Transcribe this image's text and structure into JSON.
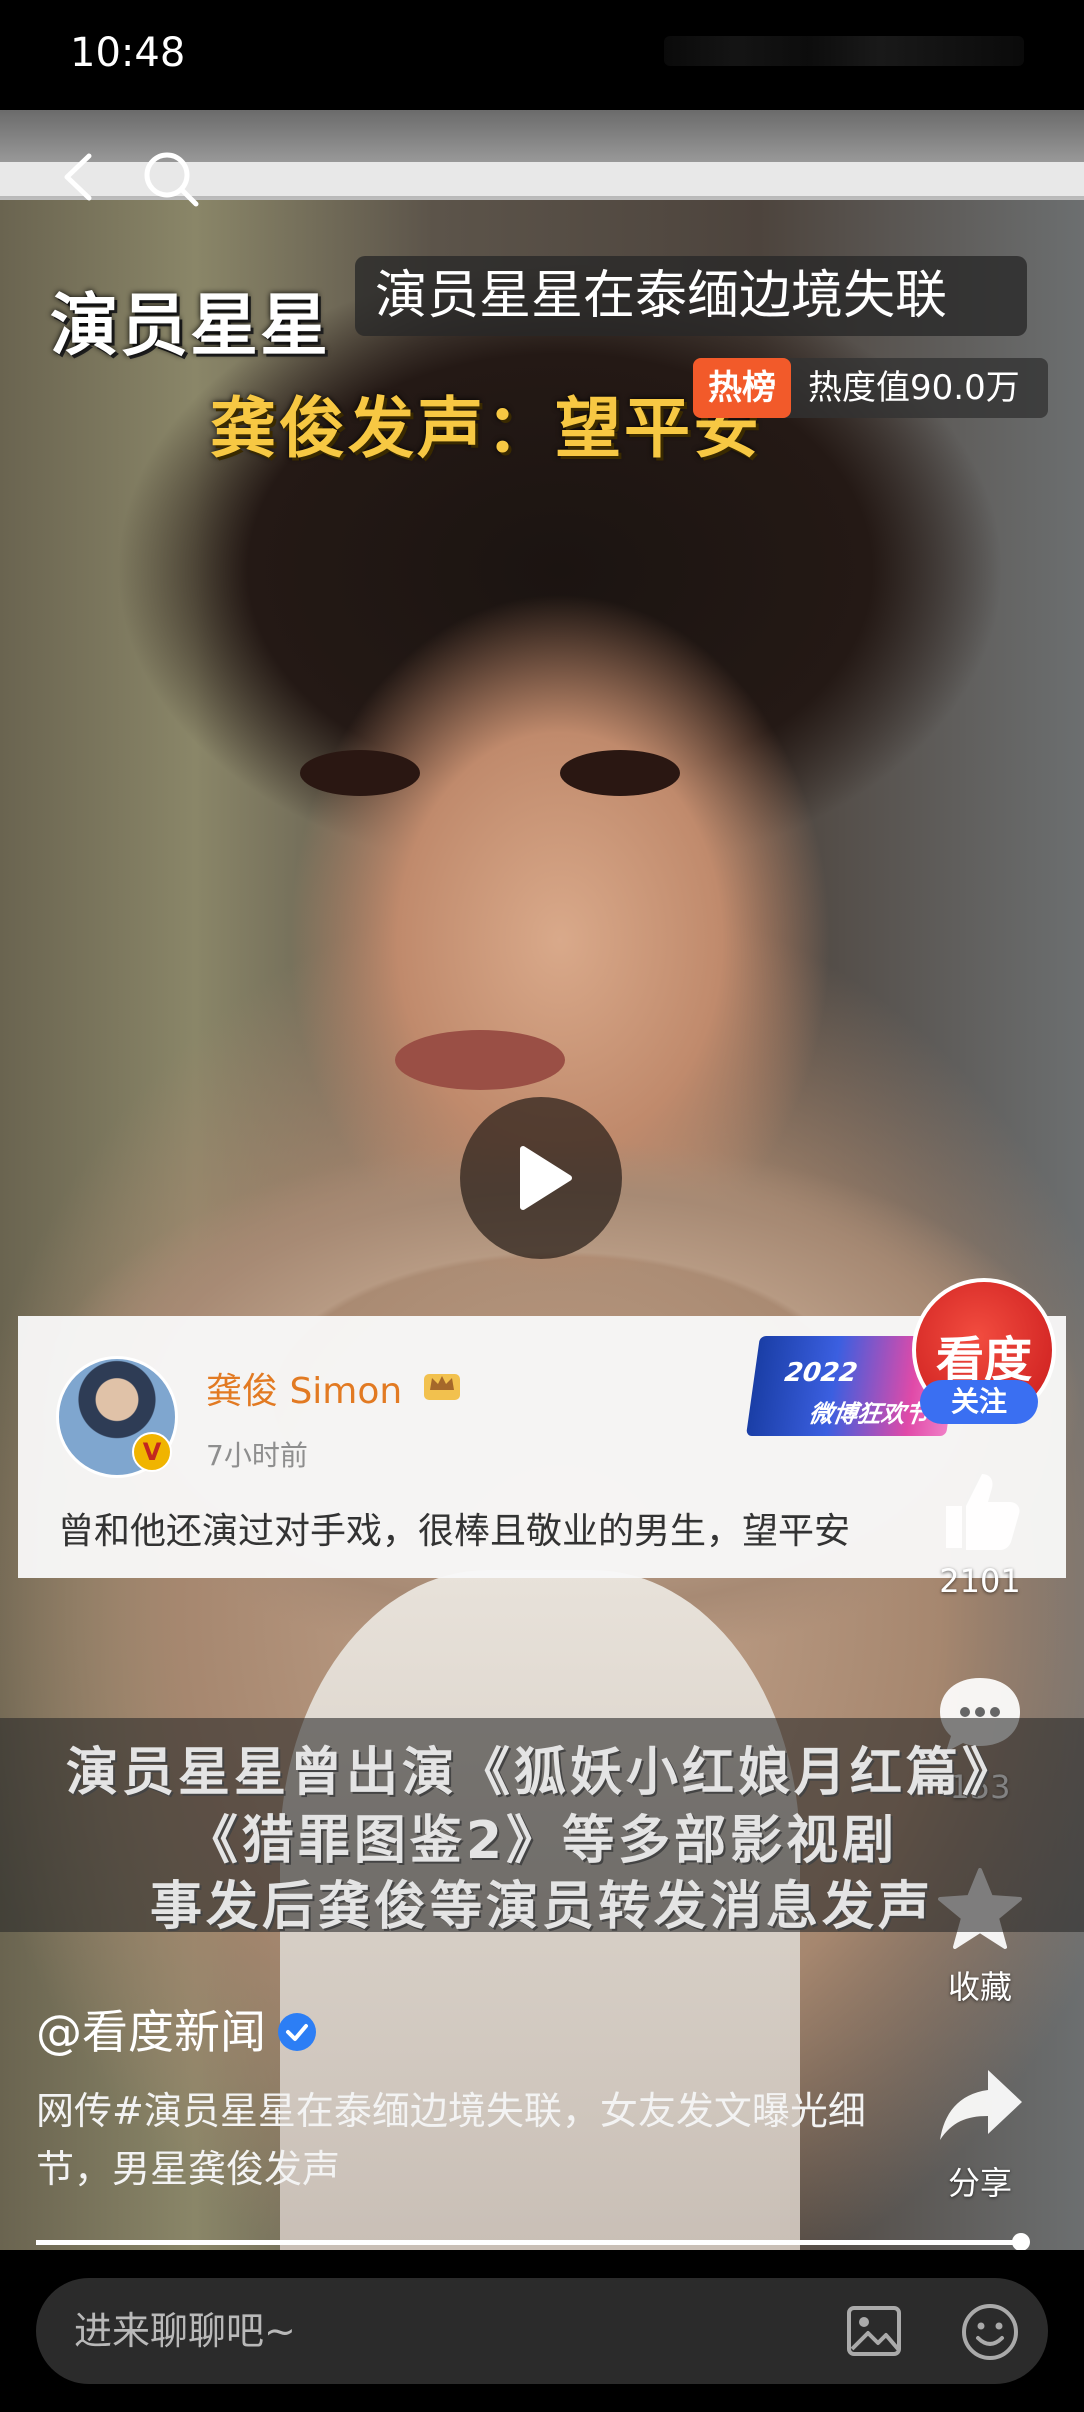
{
  "status_bar": {
    "time": "10:48"
  },
  "video": {
    "headline_line1": "演员星星",
    "headline_line2": "龚俊发声：望平安",
    "topic_title": "演员星星在泰缅边境失联",
    "hot_badge": "热榜",
    "hot_value": "热度值90.0万",
    "subtitles": [
      "演员星星曾出演《狐妖小红娘月红篇》",
      "《猎罪图鉴2》等多部影视剧",
      "事发后龚俊等演员转发消息发声"
    ],
    "progress": 0.995
  },
  "weibo_card": {
    "user_name": "龚俊 Simon",
    "time_ago": "7小时前",
    "text": "曾和他还演过对手戏，很棒且敬业的男生，望平安",
    "event_badge_line1": "2022",
    "event_badge_line2": "微博狂欢节",
    "verified_badge": "V"
  },
  "right_rail": {
    "channel_logo": "看度",
    "follow_label": "关注",
    "like_count": "2101",
    "comment_count": "153",
    "favorite_label": "收藏",
    "share_label": "分享"
  },
  "post": {
    "author": "@看度新闻",
    "description": "网传#演员星星在泰缅边境失联，女友发文曝光细节，男星龚俊发声"
  },
  "comment_bar": {
    "placeholder": "进来聊聊吧~"
  },
  "colors": {
    "accent_orange": "#f25a2a",
    "follow_blue": "#3a6ff2",
    "headline_yellow": "#f7c843",
    "username_orange": "#e27a22"
  }
}
